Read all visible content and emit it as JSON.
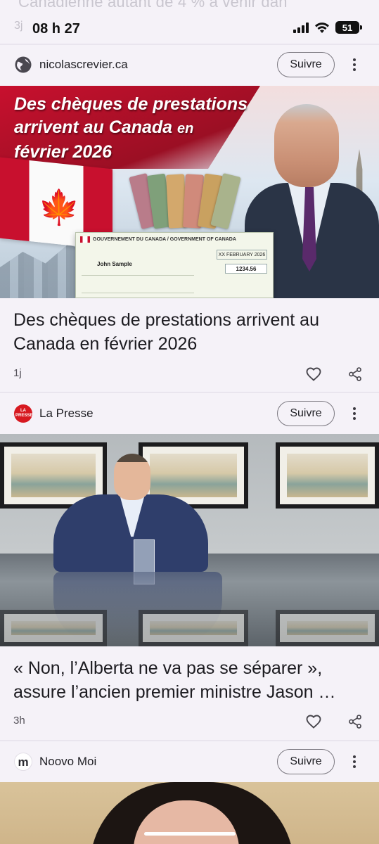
{
  "status_bar": {
    "time": "08 h 27",
    "battery": "51",
    "ghost_headline": "Canadienne autant de 4 % à venir dan",
    "ghost_age": "3j"
  },
  "articles": [
    {
      "source": "nicolascrevier.ca",
      "source_icon": "globe-icon",
      "follow_label": "Suivre",
      "image": {
        "banner_title_line1": "Des chèques de prestations",
        "banner_title_line2": "arrivent au Canada",
        "banner_title_line2b": "en",
        "banner_title_line3": "février 2026",
        "cheque_header": "GOUVERNEMENT DU CANADA / GOVERNMENT OF CANADA",
        "cheque_date": "XX FEBRUARY 2026",
        "cheque_name": "John Sample",
        "cheque_amount": "1234.56"
      },
      "headline": "Des chèques de prestations arrivent au Canada en février 2026",
      "age": "1j"
    },
    {
      "source": "La Presse",
      "source_icon": "la-presse-logo",
      "source_logo_text": "LA PRESSE",
      "follow_label": "Suivre",
      "headline": "« Non, l’Alberta ne va pas se séparer », assure l’ancien premier ministre Jason …",
      "age": "3h"
    },
    {
      "source": "Noovo Moi",
      "source_icon": "noovo-moi-logo",
      "source_logo_text": "m",
      "follow_label": "Suivre"
    }
  ],
  "colors": {
    "background": "#f5f2f8",
    "canada_red": "#c8102e",
    "la_presse_red": "#d71920"
  }
}
